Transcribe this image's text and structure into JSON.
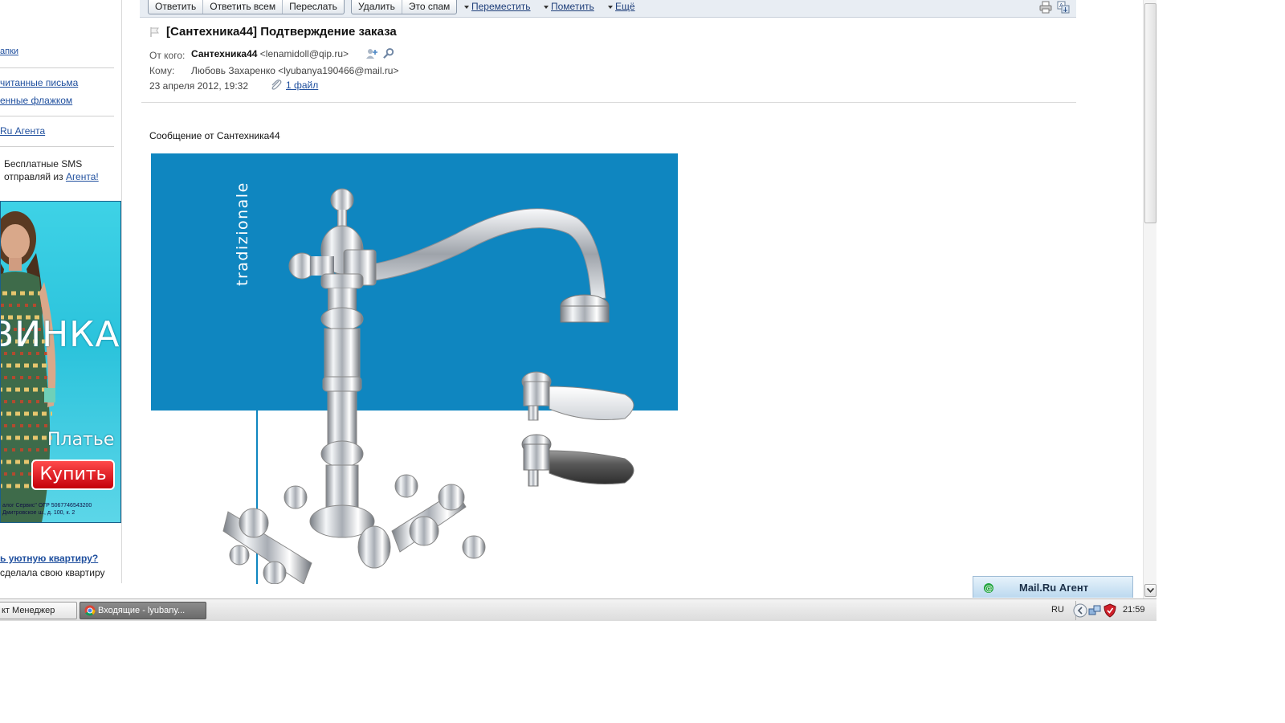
{
  "toolbar": {
    "reply": "Ответить",
    "reply_all": "Ответить всем",
    "forward": "Переслать",
    "delete": "Удалить",
    "spam": "Это спам",
    "move": "Переместить",
    "mark": "Пометить",
    "more": "Ещё"
  },
  "message": {
    "subject": "[Сантехника44] Подтверждение заказа",
    "from_label": "От кого:",
    "from_name": "Сантехника44",
    "from_email": "<lenamidoll@qip.ru>",
    "to_label": "Кому:",
    "to_value": "Любовь Захаренко <lyubanya190466@mail.ru>",
    "date": "23 апреля 2012, 19:32",
    "attachment": "1 файл",
    "body_intro": "Сообщение от Сантехника44",
    "image_caption": "tradizionale"
  },
  "sidebar": {
    "folders_link": "апки",
    "unread_link": "читанные письма",
    "flagged_link": "енные флажком",
    "agent_link": "Ru Агента",
    "sms_text_1": "Бесплатные SMS",
    "sms_text_2": "отправляй из ",
    "sms_link": "Агента!",
    "promo_link": "ь уютную квартиру?",
    "promo_text": "сделала свою квартиру"
  },
  "ad": {
    "brand": "ВИНКА",
    "product": "Платье",
    "buy_button": "Купить",
    "legal_1": "алог Сервис\" ОГР 5067746543200",
    "legal_2": "Дмитровское ш., д. 100, к. 2"
  },
  "agent_bar": {
    "label": "Mail.Ru Агент"
  },
  "taskbar": {
    "task1": "кт Менеджер",
    "task2": "Входящие - lyubany...",
    "lang": "RU",
    "time": "21:59"
  }
}
